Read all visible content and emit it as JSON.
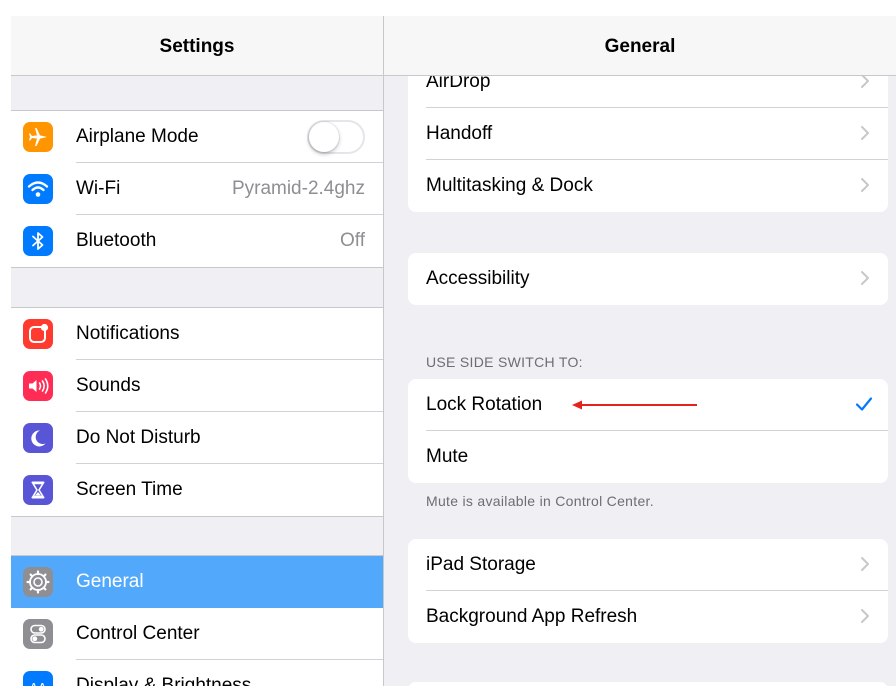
{
  "left_pane": {
    "title": "Settings",
    "group1": [
      {
        "label": "Airplane Mode",
        "icon": "airplane-icon",
        "color": "#ff9500",
        "toggle": false
      },
      {
        "label": "Wi-Fi",
        "icon": "wifi-icon",
        "color": "#007aff",
        "value": "Pyramid-2.4ghz"
      },
      {
        "label": "Bluetooth",
        "icon": "bluetooth-icon",
        "color": "#007aff",
        "value": "Off"
      }
    ],
    "group2": [
      {
        "label": "Notifications",
        "icon": "notifications-icon",
        "color": "#ff3b30"
      },
      {
        "label": "Sounds",
        "icon": "sounds-icon",
        "color": "#ff2d55"
      },
      {
        "label": "Do Not Disturb",
        "icon": "moon-icon",
        "color": "#5856d6"
      },
      {
        "label": "Screen Time",
        "icon": "hourglass-icon",
        "color": "#5856d6"
      }
    ],
    "group3": [
      {
        "label": "General",
        "icon": "gear-icon",
        "color": "#8e8e93",
        "selected": true
      },
      {
        "label": "Control Center",
        "icon": "control-center-icon",
        "color": "#8e8e93"
      },
      {
        "label": "Display & Brightness",
        "icon": "display-brightness-icon",
        "color": "#007aff"
      }
    ]
  },
  "right_pane": {
    "title": "General",
    "card1": [
      "AirDrop",
      "Handoff",
      "Multitasking & Dock"
    ],
    "card2": [
      "Accessibility"
    ],
    "side_switch_header": "USE SIDE SWITCH TO:",
    "side_switch": {
      "lock_rotation": "Lock Rotation",
      "mute": "Mute",
      "selected": "Lock Rotation"
    },
    "side_switch_footer": "Mute is available in Control Center.",
    "card4": [
      "iPad Storage",
      "Background App Refresh"
    ]
  },
  "colors": {
    "accent": "#007aff",
    "selected_row": "#52a9fb",
    "annotation_arrow": "#e5221c"
  }
}
